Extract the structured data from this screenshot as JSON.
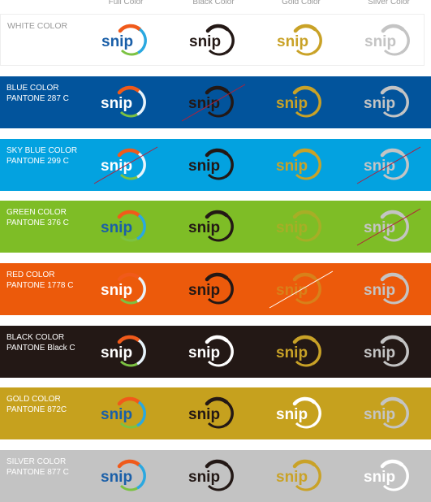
{
  "columns": [
    "Full Color",
    "Black Color",
    "Gold Color",
    "Silver Color"
  ],
  "logo_text": "snip",
  "colors": {
    "brand_blue": "#1a5fa8",
    "orange": "#f05a1a",
    "sky": "#2aa8e0",
    "green": "#7cc242",
    "black": "#231815",
    "gold": "#c9a227",
    "silver": "#c4c4c4",
    "white": "#ffffff"
  },
  "rows": [
    {
      "name": "white",
      "label": "WHITE COLOR",
      "pantone": "",
      "bg": "#ffffff",
      "cells": [
        {
          "v": "full",
          "x": false
        },
        {
          "v": "black",
          "x": false
        },
        {
          "v": "gold",
          "x": false
        },
        {
          "v": "silver",
          "x": false
        }
      ]
    },
    {
      "name": "blue",
      "label": "BLUE COLOR",
      "pantone": "PANTONE 287 C",
      "bg": "#02549c",
      "cells": [
        {
          "v": "fullw",
          "x": false
        },
        {
          "v": "black",
          "x": true
        },
        {
          "v": "gold",
          "x": false
        },
        {
          "v": "silver",
          "x": false
        }
      ]
    },
    {
      "name": "sky-blue",
      "label": "SKY BLUE COLOR",
      "pantone": "PANTONE 299 C",
      "bg": "#03a2e0",
      "cells": [
        {
          "v": "fullw",
          "x": true
        },
        {
          "v": "black",
          "x": false
        },
        {
          "v": "gold",
          "x": false
        },
        {
          "v": "silver",
          "x": true
        }
      ]
    },
    {
      "name": "green",
      "label": "GREEN COLOR",
      "pantone": "PANTONE 376 C",
      "bg": "#7ebd26",
      "cells": [
        {
          "v": "full",
          "x": false
        },
        {
          "v": "black",
          "x": false
        },
        {
          "v": "goldf",
          "x": false
        },
        {
          "v": "silver",
          "x": true
        }
      ]
    },
    {
      "name": "red",
      "label": "RED COLOR",
      "pantone": "PANTONE 1778 C",
      "bg": "#ec5a0b",
      "cells": [
        {
          "v": "fullw",
          "x": false
        },
        {
          "v": "black",
          "x": false
        },
        {
          "v": "goldf",
          "x": true
        },
        {
          "v": "silver",
          "x": false
        }
      ]
    },
    {
      "name": "black",
      "label": "BLACK COLOR",
      "pantone": "PANTONE Black C",
      "bg": "#231815",
      "cells": [
        {
          "v": "fullw",
          "x": false
        },
        {
          "v": "white",
          "x": false
        },
        {
          "v": "gold",
          "x": false
        },
        {
          "v": "silver",
          "x": false
        }
      ]
    },
    {
      "name": "gold",
      "label": "GOLD COLOR",
      "pantone": "PANTONE 872C",
      "bg": "#c6a11e",
      "cells": [
        {
          "v": "full",
          "x": false
        },
        {
          "v": "black",
          "x": false
        },
        {
          "v": "white",
          "x": false
        },
        {
          "v": "silver",
          "x": false
        }
      ]
    },
    {
      "name": "silver",
      "label": "SILVER COLOR",
      "pantone": "PANTONE 877 C",
      "bg": "#c3c3c3",
      "cells": [
        {
          "v": "full",
          "x": false
        },
        {
          "v": "black",
          "x": false
        },
        {
          "v": "gold",
          "x": false
        },
        {
          "v": "white",
          "x": false
        }
      ]
    }
  ]
}
